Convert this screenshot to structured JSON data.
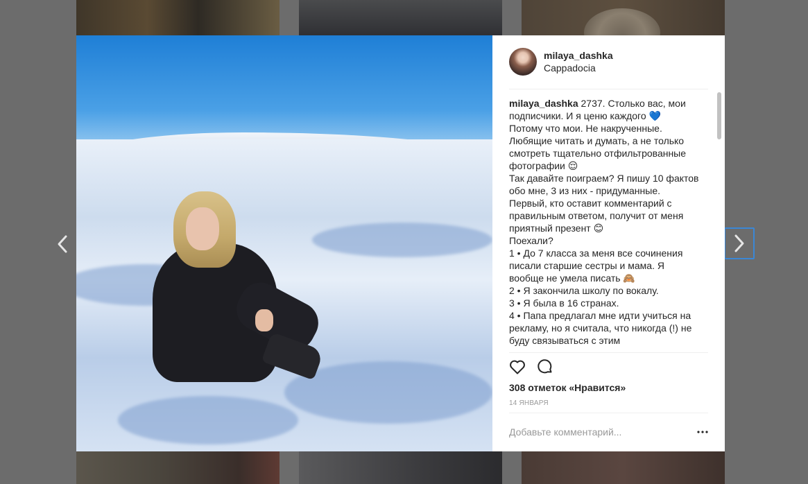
{
  "post": {
    "username": "milaya_dashka",
    "location": "Cappadocia",
    "caption_user": "milaya_dashka",
    "caption_text": "2737. Столько вас, мои подписчики. И я ценю каждого 💙\nПотому что мои. Не накрученные. Любящие читать и думать, а не только смотреть тщательно отфильтрованные фотографии 😌\nТак давайте поиграем? Я пишу 10 фактов обо мне, 3 из них - придуманные. Первый, кто оставит комментарий с правильным ответом, получит от меня приятный презент 😊\nПоехали?\n1 • До 7 класса за меня все сочинения писали старшие сестры и мама. Я вообще не умела писать 🙈\n2 • Я закончила школу по вокалу.\n3 • Я была в 16 странах.\n4 • Папа предлагал мне идти учиться на рекламу, но я считала, что никогда (!) не буду связываться с этим",
    "likes": "308 отметок «Нравится»",
    "date": "14 января"
  },
  "comment": {
    "placeholder": "Добавьте комментарий..."
  },
  "icons": {
    "prev": "chevron-left-icon",
    "next": "chevron-right-icon",
    "like": "heart-icon",
    "comment": "speech-bubble-icon",
    "more": "ellipsis-icon"
  },
  "colors": {
    "focus_border": "#3b87d6",
    "text": "#262626",
    "muted": "#999999"
  }
}
